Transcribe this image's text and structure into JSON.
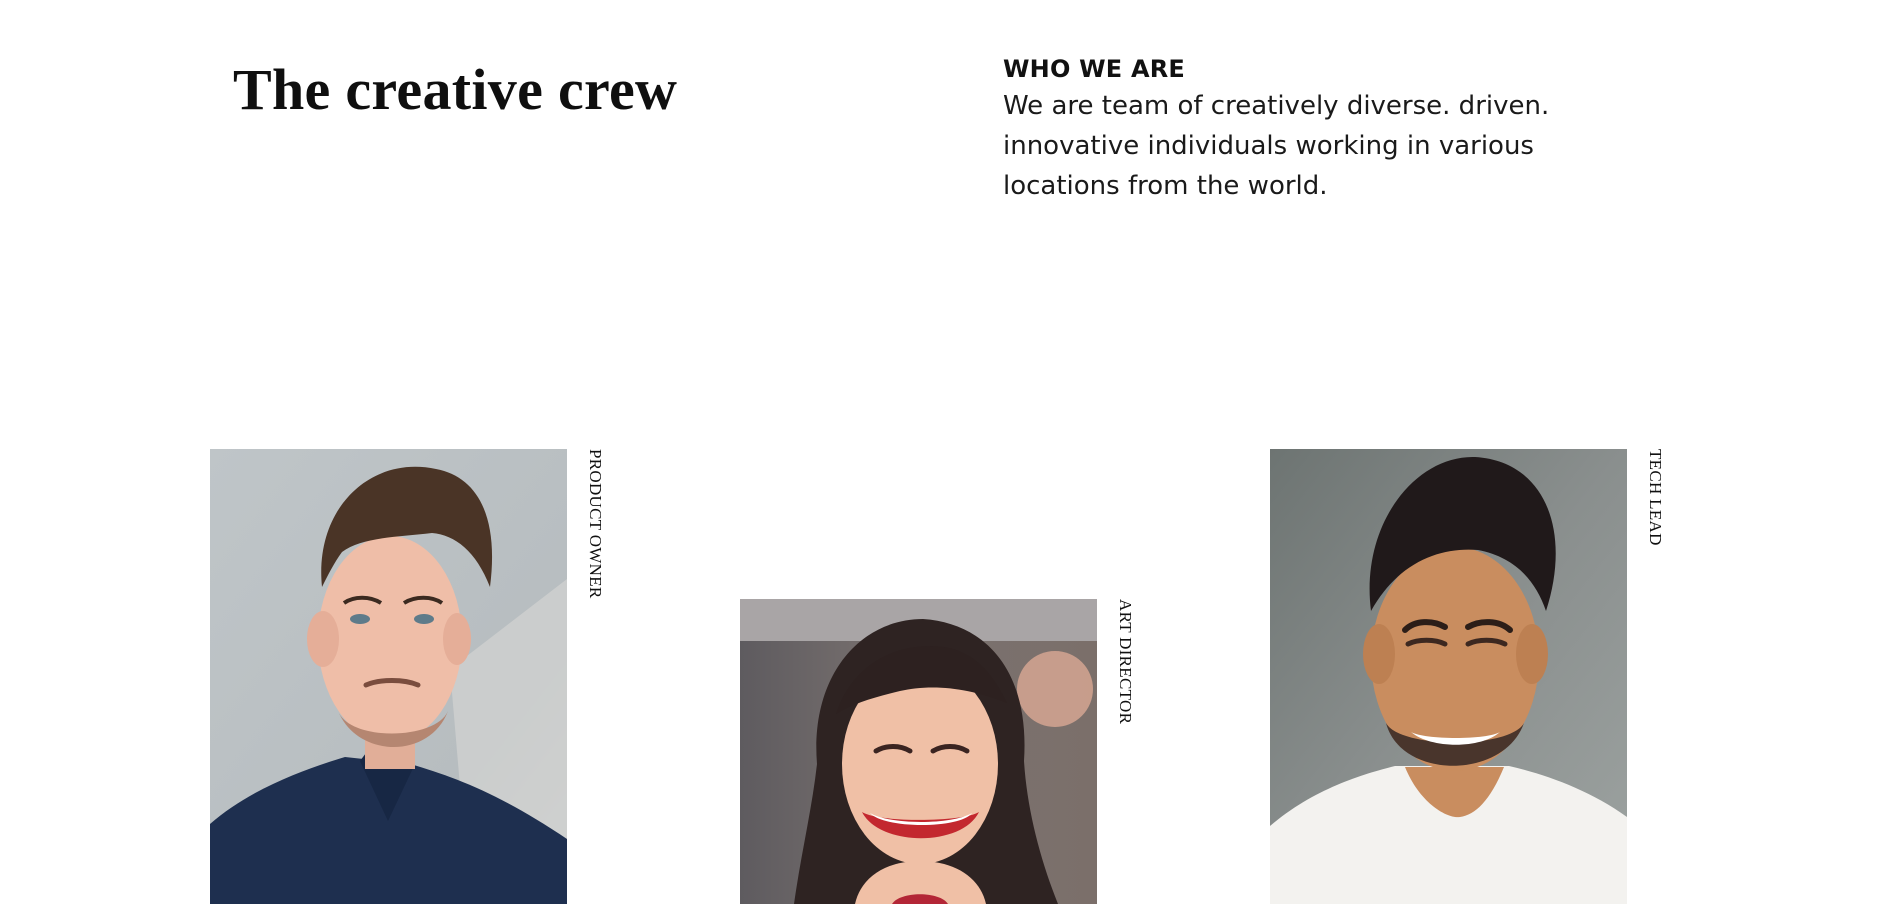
{
  "hero": {
    "title": "The creative crew"
  },
  "about": {
    "heading": "WHO WE ARE",
    "text": "We are team of creatively diverse. driven. innovative individuals working in various locations from the world."
  },
  "team": [
    {
      "role": "PRODUCT OWNER"
    },
    {
      "role": "ART DIRECTOR"
    },
    {
      "role": "TECH LEAD"
    }
  ]
}
